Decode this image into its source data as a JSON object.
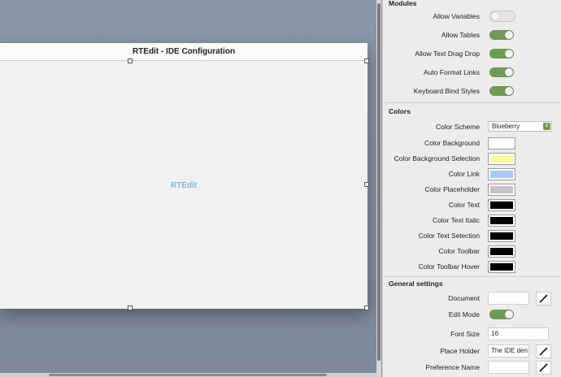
{
  "window": {
    "title": "RTEdit - IDE Configuration",
    "content_label": "RTEdit"
  },
  "modules": {
    "heading": "Modules",
    "items": [
      {
        "label": "Allow Variables",
        "on": false
      },
      {
        "label": "Allow Tables",
        "on": true
      },
      {
        "label": "Allow Text Drag Drop",
        "on": true
      },
      {
        "label": "Auto Format Links",
        "on": true
      },
      {
        "label": "Keyboard Bind Styles",
        "on": true
      }
    ]
  },
  "colors": {
    "heading": "Colors",
    "scheme_label": "Color Scheme",
    "scheme_value": "Blueberry",
    "items": [
      {
        "label": "Color Background",
        "color": "#ffffff"
      },
      {
        "label": "Color Background Selection",
        "color": "#fdfd9e"
      },
      {
        "label": "Color Link",
        "color": "#a9c8f5"
      },
      {
        "label": "Color Placeholder",
        "color": "#c4c4c4"
      },
      {
        "label": "Color Text",
        "color": "#000000"
      },
      {
        "label": "Color Text Italic",
        "color": "#000000"
      },
      {
        "label": "Color Text Selection",
        "color": "#000000"
      },
      {
        "label": "Color Toolbar",
        "color": "#000000"
      },
      {
        "label": "Color Toolbar Hover",
        "color": "#000000"
      }
    ]
  },
  "general": {
    "heading": "General settings",
    "document_label": "Document",
    "document_value": "",
    "edit_mode_label": "Edit Mode",
    "edit_mode_on": true,
    "font_size_label": "Font Size",
    "font_size_value": "16",
    "place_holder_label": "Place Holder",
    "place_holder_value": "The IDE den",
    "preference_name_label": "Preference Name",
    "preference_name_value": ""
  }
}
